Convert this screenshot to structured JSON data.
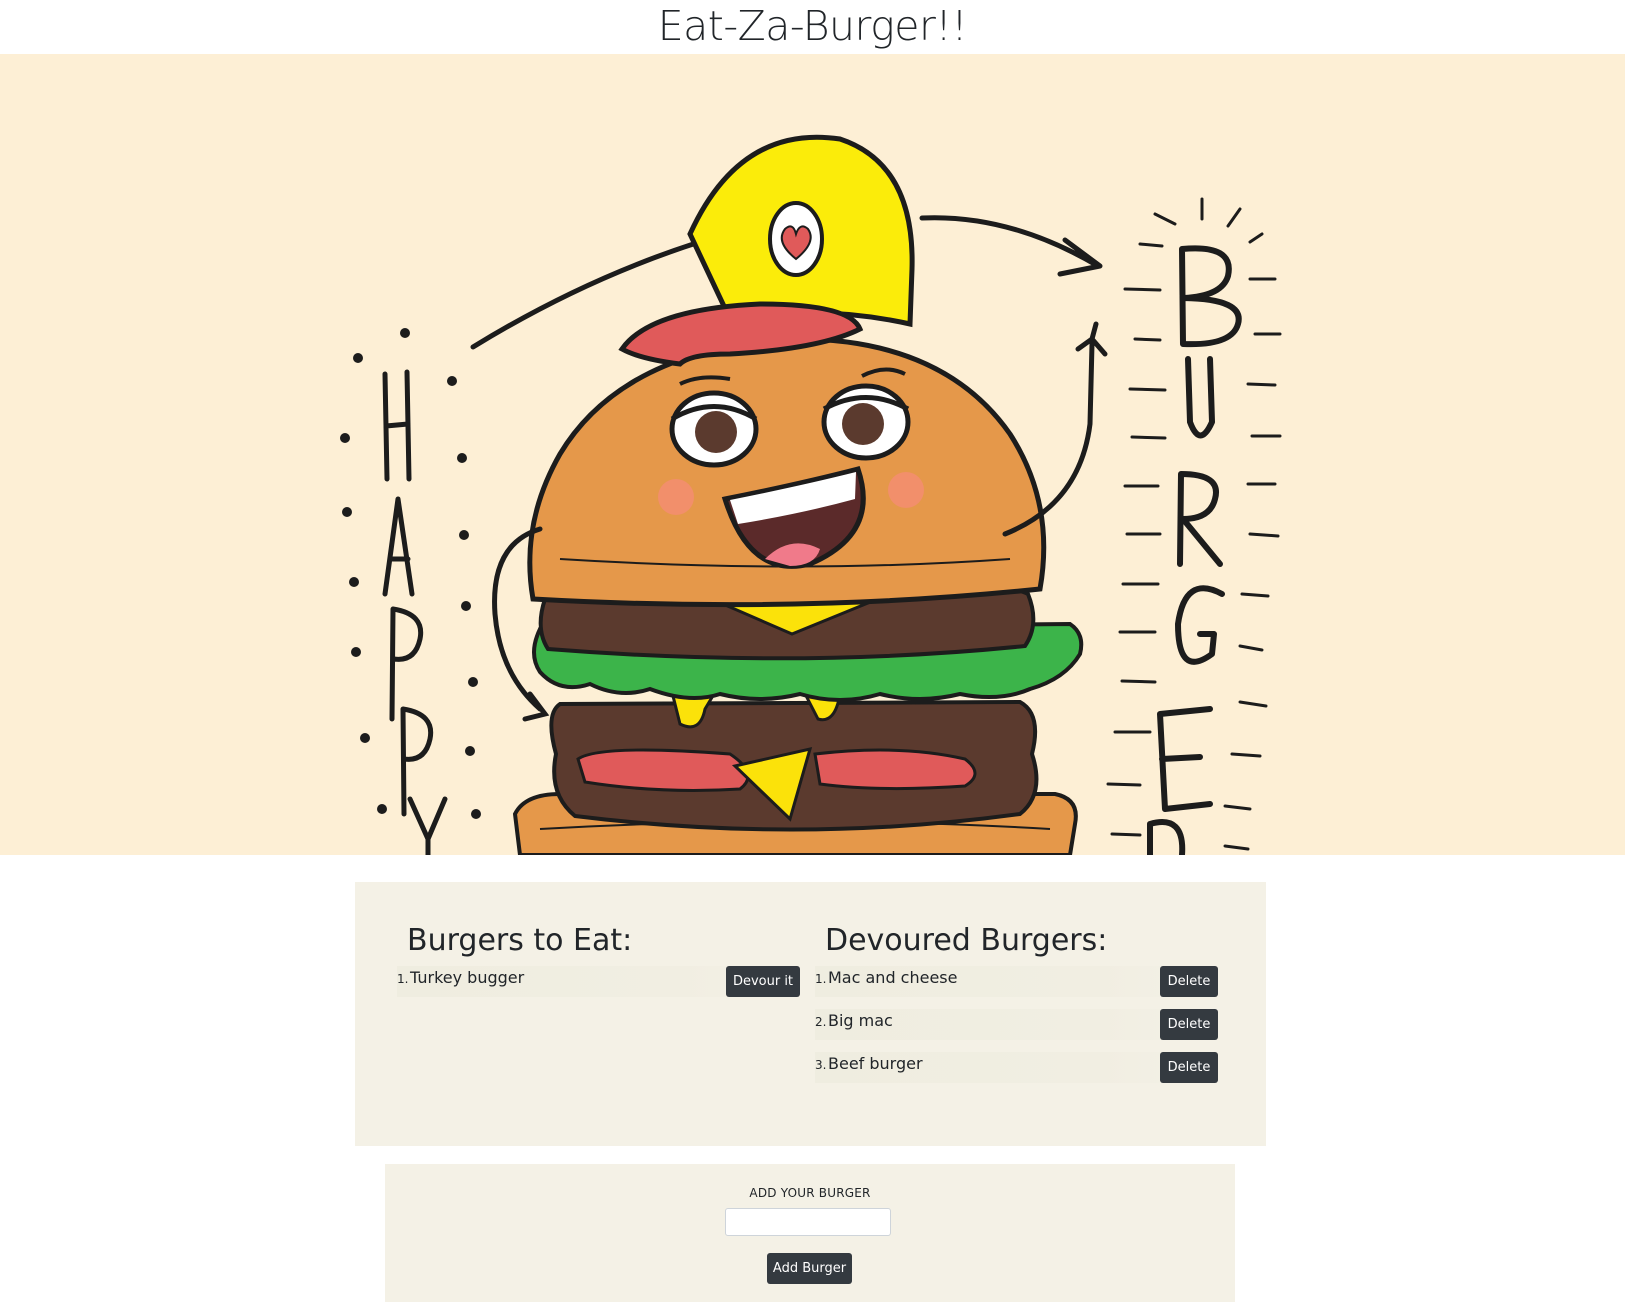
{
  "header": {
    "title": "Eat-Za-Burger!!"
  },
  "hero": {
    "image_name": "happy-burger-illustration-icon",
    "lettering_left": "HAPPY",
    "lettering_right": "BURGER"
  },
  "burgers_to_eat": {
    "heading": "Burgers to Eat:",
    "items": [
      {
        "number": "1.",
        "name": "Turkey bugger",
        "button": "Devour it"
      }
    ]
  },
  "devoured_burgers": {
    "heading": "Devoured Burgers:",
    "items": [
      {
        "number": "1.",
        "name": "Mac and cheese",
        "button": "Delete"
      },
      {
        "number": "2.",
        "name": "Big mac",
        "button": "Delete"
      },
      {
        "number": "3.",
        "name": "Beef burger",
        "button": "Delete"
      }
    ]
  },
  "add_form": {
    "label": "ADD YOUR BURGER",
    "input_value": "",
    "button": "Add Burger"
  },
  "colors": {
    "hero_background": "#fdefd5",
    "panel_background": "#f4f1e6",
    "button_dark": "#343a40",
    "text": "#212529"
  }
}
